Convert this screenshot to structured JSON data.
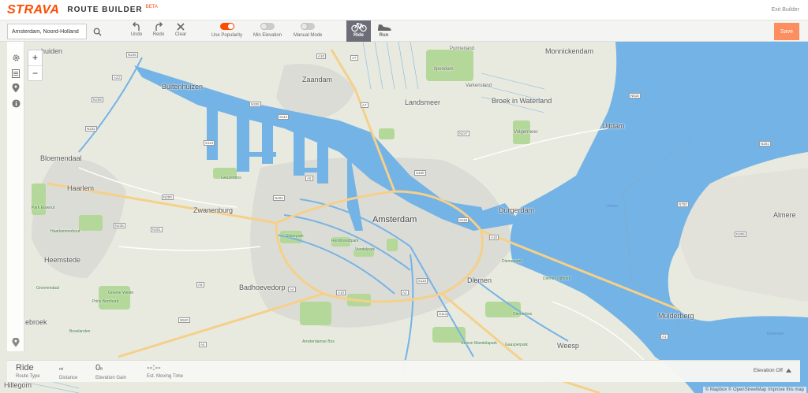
{
  "header": {
    "logo": "STRAVA",
    "product": "ROUTE BUILDER",
    "beta": "BETA",
    "exit": "Exit Builder"
  },
  "toolbar": {
    "search": {
      "value": "Amsterdam, Noord-Holland",
      "icon": "search-icon"
    },
    "undo": "Undo",
    "redo": "Redo",
    "clear": "Clear",
    "toggles": [
      {
        "label": "Use Popularity",
        "on": true
      },
      {
        "label": "Min Elevation",
        "on": false
      },
      {
        "label": "Manual Mode",
        "on": false
      }
    ],
    "modes": [
      {
        "label": "Ride",
        "active": true,
        "icon": "bike-icon"
      },
      {
        "label": "Run",
        "active": false,
        "icon": "shoe-icon"
      }
    ],
    "save": "Save"
  },
  "map": {
    "places": {
      "amsterdam": "Amsterdam",
      "zaandam": "Zaandam",
      "haarlem": "Haarlem",
      "zwanenburg": "Zwanenburg",
      "diemen": "Diemen",
      "almere": "Almere",
      "monnickendam": "Monnickendam",
      "landsmeer": "Landsmeer",
      "broek": "Broek in Waterland",
      "uitdam": "Uitdam",
      "durgerdam": "Durgerdam",
      "muiderberg": "Muiderberg",
      "weesp": "Weesp",
      "badhoevedorp": "Badhoevedorp",
      "heemstede": "Heemstede",
      "bloemendaal": "Bloemendaal",
      "buitenhuizen": "Buitenhuizen",
      "hillegom": "Hillegom",
      "huiden": "huiden",
      "ebroek": "ebroek",
      "ilpendam": "Ilpendam",
      "purmerland": "Purmerland",
      "volgermeer": "Volgermeer",
      "varkensland": "Varkensland",
      "geuzenbos": "Geuzenbos",
      "sloterpark": "Sloterpark",
      "rembrandtpark": "Rembrandtpark",
      "vondelpark": "Vondelpark",
      "diemerpark": "Diemerpark",
      "diemervijfhoek": "Diemer Vijfhoek",
      "diemerbos": "Diemerbos",
      "gaasperpark": "Gaasperpark",
      "nelsonmandelapark": "Nelson Mandelapark",
      "amsterdamsebos": "Amsterdamse Bos",
      "elsenwout": "Park Elswout",
      "haarlemmerhout": "Haarlemmerhout",
      "groenendaal": "Groenendaal",
      "princebernhard": "Prins Bernhard",
      "groeneweide": "Groene Weide",
      "boselanden": "Boselanden",
      "ijmeer": "IJmeer",
      "gooimeer": "Gooimeer"
    },
    "roads": [
      "N246",
      "A8",
      "A10",
      "A7",
      "A22",
      "N208",
      "N200",
      "N201",
      "N202",
      "A5",
      "A9",
      "A4",
      "A2",
      "N516",
      "N518",
      "N247",
      "N520",
      "A1",
      "N236",
      "N305",
      "N702",
      "N301",
      "N232",
      "N205",
      "S100",
      "S118",
      "S114",
      "S112",
      "S110",
      "S116",
      "S106",
      "S108",
      "S113",
      "S102",
      "S200"
    ]
  },
  "rail": {
    "icons": [
      "gear-icon",
      "list-icon",
      "pin-icon",
      "info-icon",
      "marker-icon"
    ]
  },
  "zoom": {
    "in": "+",
    "out": "−"
  },
  "stats": {
    "route_type": {
      "value": "Ride",
      "label": "Route Type"
    },
    "distance": {
      "value": "",
      "unit": "mi",
      "label": "Distance"
    },
    "elevation": {
      "value": "0",
      "unit": "ft",
      "label": "Elevation Gain"
    },
    "time": {
      "value": "--:--",
      "label": "Est. Moving Time"
    },
    "elevation_toggle": "Elevation Off"
  },
  "attribution": "© Mapbox © OpenStreetMap Improve this map",
  "colors": {
    "accent": "#fc4c02",
    "save": "#fc8e60",
    "water": "#74b3e6",
    "land": "#e8eadf",
    "park": "#b4d89a",
    "mode_active": "#6d6d78"
  }
}
